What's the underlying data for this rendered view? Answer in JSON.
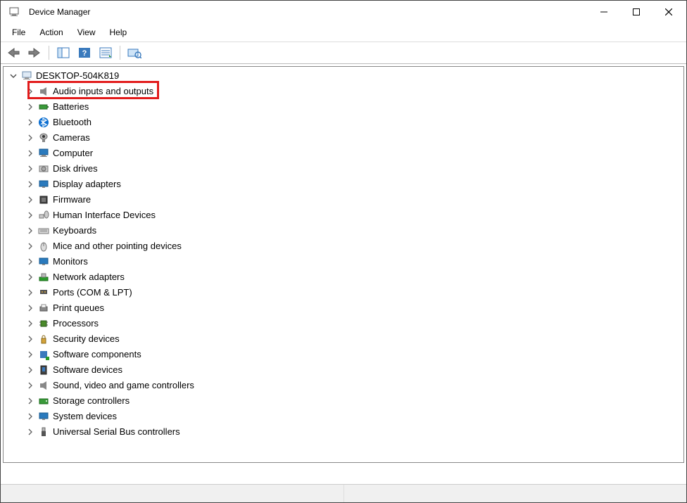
{
  "window": {
    "title": "Device Manager"
  },
  "menu": {
    "file": "File",
    "action": "Action",
    "view": "View",
    "help": "Help"
  },
  "tree": {
    "root": "DESKTOP-504K819",
    "items": [
      "Audio inputs and outputs",
      "Batteries",
      "Bluetooth",
      "Cameras",
      "Computer",
      "Disk drives",
      "Display adapters",
      "Firmware",
      "Human Interface Devices",
      "Keyboards",
      "Mice and other pointing devices",
      "Monitors",
      "Network adapters",
      "Ports (COM & LPT)",
      "Print queues",
      "Processors",
      "Security devices",
      "Software components",
      "Software devices",
      "Sound, video and game controllers",
      "Storage controllers",
      "System devices",
      "Universal Serial Bus controllers"
    ]
  },
  "highlighted_index": 0
}
